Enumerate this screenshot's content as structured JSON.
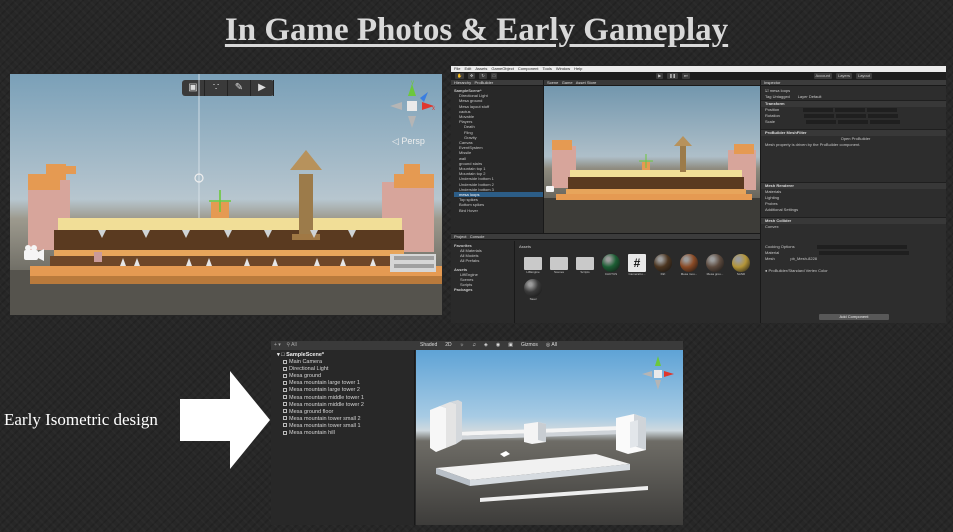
{
  "slide": {
    "title": "In Game Photos & Early Gameplay",
    "iso_caption": "Early Isometric design"
  },
  "scene_view": {
    "toolbar_icons": [
      "cube-icon",
      "nodes-icon",
      "brush-icon",
      "tag-icon"
    ],
    "persp_label": "◁ Persp"
  },
  "editor": {
    "menu": [
      "File",
      "Edit",
      "Assets",
      "GameObject",
      "Component",
      "Tools",
      "Window",
      "Help"
    ],
    "toolbar_right": [
      "Account",
      "Layers",
      "Layout"
    ],
    "tabs": {
      "hierarchy": "Hierarchy",
      "probuilder": "ProBuilder",
      "scene": "Scene",
      "game": "Game",
      "asset_store": "Asset Store",
      "inspector": "Inspector",
      "project": "Project",
      "console": "Console"
    },
    "hierarchy_items": [
      "SampleScene*",
      "Directional Light",
      "Mesa ground",
      "Mesa layout stuff",
      "cactus",
      "Movable",
      "Players",
      "Death",
      "Fling",
      "Gravity",
      "Canvas",
      "EventSystem",
      "Missile",
      "wall",
      "ground stairs",
      "Mountain top 1",
      "Mountain top 2",
      "Underside bottom 1",
      "Underside bottom 2",
      "Underside bottom 3",
      "mesa loops",
      "Top spikes",
      "Bottom spikes",
      "Bird Hover"
    ],
    "hierarchy_selected_index": 20,
    "inspector": {
      "object_name": "mesa loops",
      "tag": "Untagged",
      "layer": "Default",
      "transform_header": "Transform",
      "position_label": "Position",
      "rotation_label": "Rotation",
      "scale_label": "Scale",
      "meshfilter_header": "ProBuilder MeshFilter",
      "open_probuilder": "Open ProBuilder",
      "meshfilter_note": "Mesh property is driven by the ProBuilder component.",
      "renderer_header": "Mesh Renderer",
      "materials_label": "Materials",
      "lighting_label": "Lighting",
      "probes_label": "Probes",
      "additional_label": "Additional Settings",
      "collider_header": "Mesh Collider",
      "convex_label": "Convex",
      "cooking_label": "Cooking Options",
      "material_label": "Material",
      "mesh_label": "Mesh",
      "mesh_value": "pb_Mesh-8228",
      "default_shader": "ProBuilder/Standard Vertex Color",
      "add_component": "Add Component"
    },
    "project_tree": [
      "Favorites",
      "All Materials",
      "All Models",
      "All Prefabs",
      "Assets",
      "LiftEngine",
      "Scenes",
      "Scripts",
      "Packages"
    ],
    "assets_title": "Assets",
    "assets": [
      {
        "name": "LiftEngine",
        "kind": "folder",
        "color": "#c9c9c9"
      },
      {
        "name": "Scenes",
        "kind": "folder",
        "color": "#c9c9c9"
      },
      {
        "name": "Scripts",
        "kind": "folder",
        "color": "#c9c9c9"
      },
      {
        "name": "CACTUS",
        "kind": "material",
        "color": "#1c5e34"
      },
      {
        "name": "CameraCo...",
        "kind": "script",
        "color": "#e8e8e8"
      },
      {
        "name": "Dirt",
        "kind": "material",
        "color": "#4b3520"
      },
      {
        "name": "Mesa mou...",
        "kind": "material",
        "color": "#8a4a25"
      },
      {
        "name": "Mesa grou...",
        "kind": "material",
        "color": "#5c4a3e"
      },
      {
        "name": "SAND",
        "kind": "material",
        "color": "#b49538"
      },
      {
        "name": "Steel",
        "kind": "material",
        "color": "#3a3a3a"
      }
    ]
  },
  "iso_editor": {
    "toolbar_shaded": "Shaded",
    "toolbar_2d": "2D",
    "toolbar_gizmos": "Gizmos",
    "toolbar_all": "◎ All",
    "hierarchy_root": "SampleScene*",
    "hierarchy_items": [
      "Main Camera",
      "Directional Light",
      "Mesa ground",
      "Mesa mountain large tower 1",
      "Mesa mountain large tower 2",
      "Mesa mountain middle tower 1",
      "Mesa mountain middle tower 2",
      "Mesa ground floor",
      "Mesa mountain tower small 2",
      "Mesa mountain tower small 1",
      "Mesa mountain hill"
    ]
  },
  "colors": {
    "slide_bg": "#272727",
    "title_color": "#d9d9d9",
    "selection_blue": "#2c5d87",
    "gizmo_red": "#e0362c",
    "gizmo_green": "#6cc83c",
    "gizmo_blue": "#3a7ee0",
    "mesa_orange": "#e59a52",
    "mesa_brown": "#5a3a20",
    "mesa_cream": "#f1de97"
  }
}
